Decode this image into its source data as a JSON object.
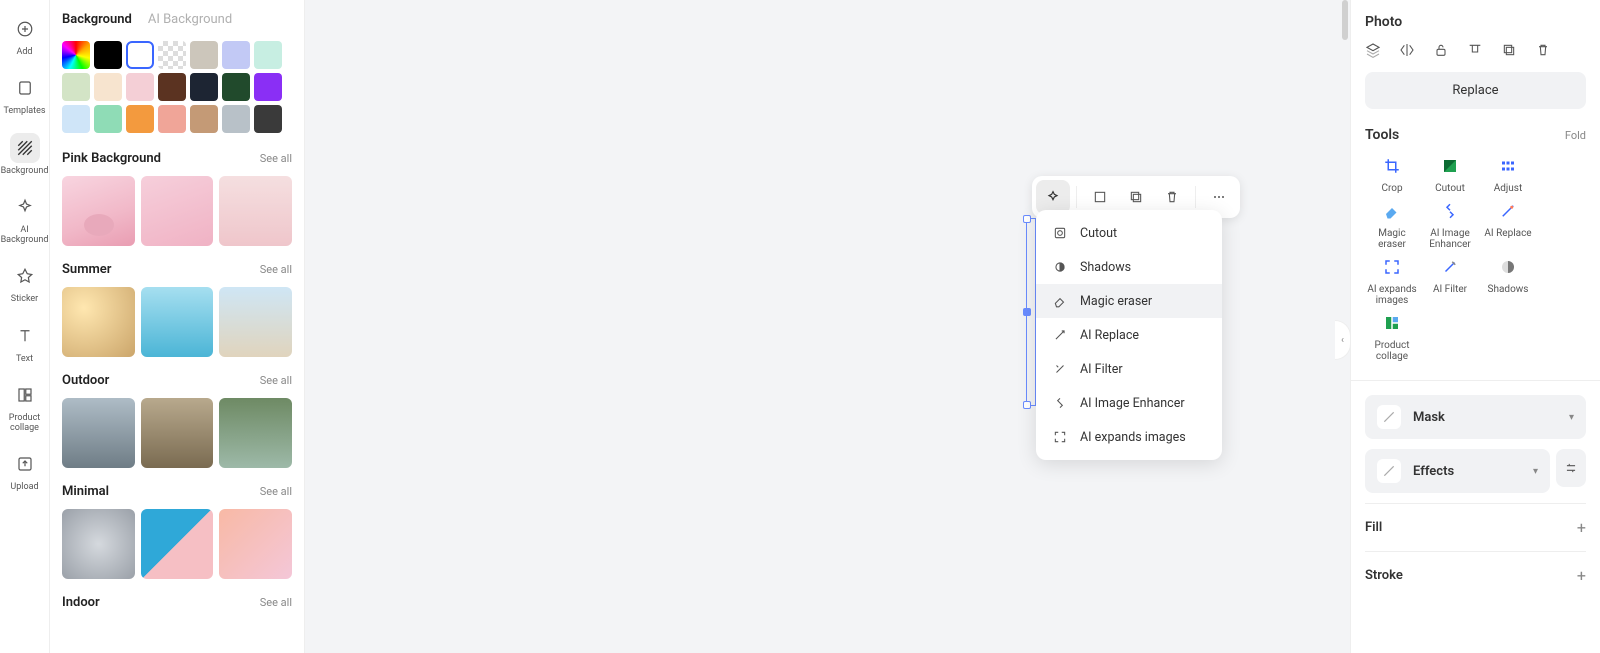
{
  "rail": {
    "add": "Add",
    "templates": "Templates",
    "background": "Background",
    "ai_background": "AI Background",
    "sticker": "Sticker",
    "text": "Text",
    "product_collage": "Product collage",
    "upload": "Upload"
  },
  "panel": {
    "tabs": {
      "bg": "Background",
      "ai_bg": "AI Background"
    },
    "see_all": "See all",
    "sections": {
      "pink": "Pink Background",
      "summer": "Summer",
      "outdoor": "Outdoor",
      "minimal": "Minimal",
      "indoor": "Indoor"
    }
  },
  "context_menu": {
    "cutout": "Cutout",
    "shadows": "Shadows",
    "magic_eraser": "Magic eraser",
    "ai_replace": "AI Replace",
    "ai_filter": "AI Filter",
    "ai_enhancer": "AI Image Enhancer",
    "ai_expand": "AI expands images"
  },
  "right": {
    "title": "Photo",
    "replace": "Replace",
    "tools_title": "Tools",
    "fold": "Fold",
    "tools": {
      "crop": "Crop",
      "cutout": "Cutout",
      "adjust": "Adjust",
      "magic_eraser": "Magic eraser",
      "ai_enhancer": "AI Image Enhancer",
      "ai_replace": "AI Replace",
      "ai_expand": "AI expands images",
      "ai_filter": "AI Filter",
      "shadows": "Shadows",
      "product_collage": "Product collage"
    },
    "mask": "Mask",
    "effects": "Effects",
    "fill": "Fill",
    "stroke": "Stroke"
  }
}
